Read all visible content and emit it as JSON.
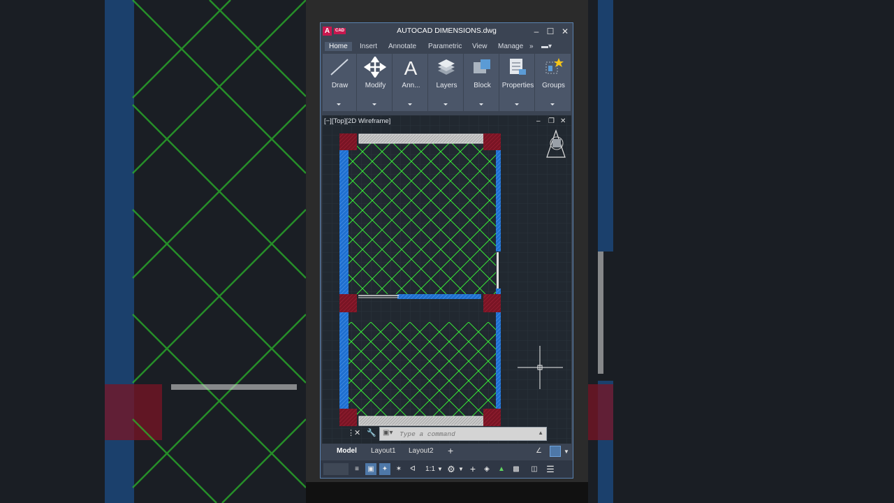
{
  "app": {
    "logo_letter": "A",
    "logo_tag": "CAD",
    "title": "AUTOCAD DIMENSIONS.dwg",
    "window_buttons": [
      "minimize",
      "maximize",
      "close"
    ]
  },
  "tabs": [
    {
      "label": "Home",
      "active": true
    },
    {
      "label": "Insert",
      "active": false
    },
    {
      "label": "Annotate",
      "active": false
    },
    {
      "label": "Parametric",
      "active": false
    },
    {
      "label": "View",
      "active": false
    },
    {
      "label": "Manage",
      "active": false
    }
  ],
  "ribbon": {
    "panels": [
      {
        "label": "Draw",
        "icon": "line-icon"
      },
      {
        "label": "Modify",
        "icon": "move-icon"
      },
      {
        "label": "Ann...",
        "icon": "text-icon"
      },
      {
        "label": "Layers",
        "icon": "layers-icon"
      },
      {
        "label": "Block",
        "icon": "block-icon"
      },
      {
        "label": "Properties",
        "icon": "properties-icon"
      },
      {
        "label": "Groups",
        "icon": "groups-icon"
      }
    ]
  },
  "viewport": {
    "label": "[−][Top][2D Wireframe]"
  },
  "command": {
    "placeholder": "Type a command"
  },
  "layout_tabs": [
    {
      "label": "Model",
      "active": true
    },
    {
      "label": "Layout1",
      "active": false
    },
    {
      "label": "Layout2",
      "active": false
    }
  ],
  "status": {
    "scale": "1:1"
  },
  "colors": {
    "hatch_green": "#39e639",
    "wall_blue": "#1e6fd0",
    "column_red": "#8b1526",
    "accent": "#4e78a8"
  }
}
